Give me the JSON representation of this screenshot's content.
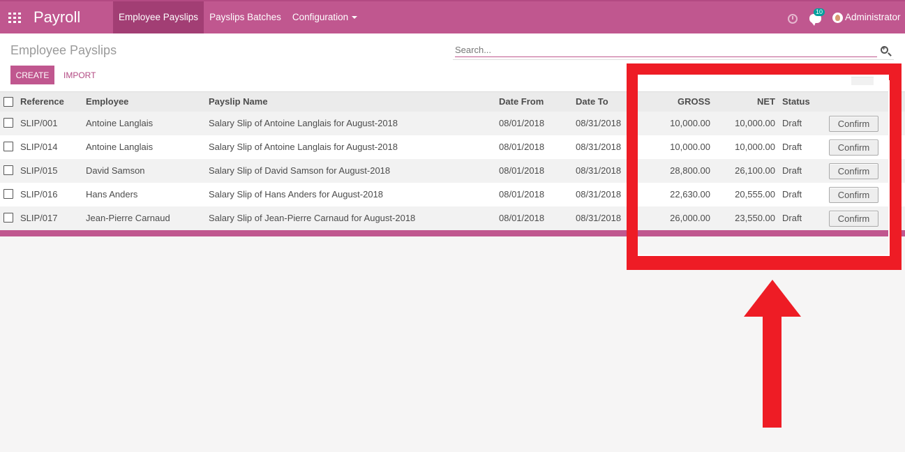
{
  "header": {
    "app_name": "Payroll",
    "menu": [
      "Employee Payslips",
      "Payslips Batches",
      "Configuration"
    ],
    "messages_badge": "10",
    "user": "Administrator"
  },
  "control": {
    "title": "Employee Payslips",
    "search_placeholder": "Search...",
    "create_label": "CREATE",
    "import_label": "IMPORT"
  },
  "table": {
    "columns": {
      "reference": "Reference",
      "employee": "Employee",
      "payslip_name": "Payslip Name",
      "date_from": "Date From",
      "date_to": "Date To",
      "gross": "GROSS",
      "net": "NET",
      "status": "Status"
    },
    "confirm_label": "Confirm",
    "rows": [
      {
        "reference": "SLIP/001",
        "employee": "Antoine Langlais",
        "payslip_name": "Salary Slip of Antoine Langlais for August-2018",
        "date_from": "08/01/2018",
        "date_to": "08/31/2018",
        "gross": "10,000.00",
        "net": "10,000.00",
        "status": "Draft"
      },
      {
        "reference": "SLIP/014",
        "employee": "Antoine Langlais",
        "payslip_name": "Salary Slip of Antoine Langlais for August-2018",
        "date_from": "08/01/2018",
        "date_to": "08/31/2018",
        "gross": "10,000.00",
        "net": "10,000.00",
        "status": "Draft"
      },
      {
        "reference": "SLIP/015",
        "employee": "David Samson",
        "payslip_name": "Salary Slip of David Samson for August-2018",
        "date_from": "08/01/2018",
        "date_to": "08/31/2018",
        "gross": "28,800.00",
        "net": "26,100.00",
        "status": "Draft"
      },
      {
        "reference": "SLIP/016",
        "employee": "Hans Anders",
        "payslip_name": "Salary Slip of Hans Anders for August-2018",
        "date_from": "08/01/2018",
        "date_to": "08/31/2018",
        "gross": "22,630.00",
        "net": "20,555.00",
        "status": "Draft"
      },
      {
        "reference": "SLIP/017",
        "employee": "Jean-Pierre Carnaud",
        "payslip_name": "Salary Slip of Jean-Pierre Carnaud for August-2018",
        "date_from": "08/01/2018",
        "date_to": "08/31/2018",
        "gross": "26,000.00",
        "net": "23,550.00",
        "status": "Draft"
      }
    ]
  },
  "colors": {
    "brand": "#c0578f",
    "brand_dark": "#a23e74",
    "annotation": "#ee1c25"
  }
}
